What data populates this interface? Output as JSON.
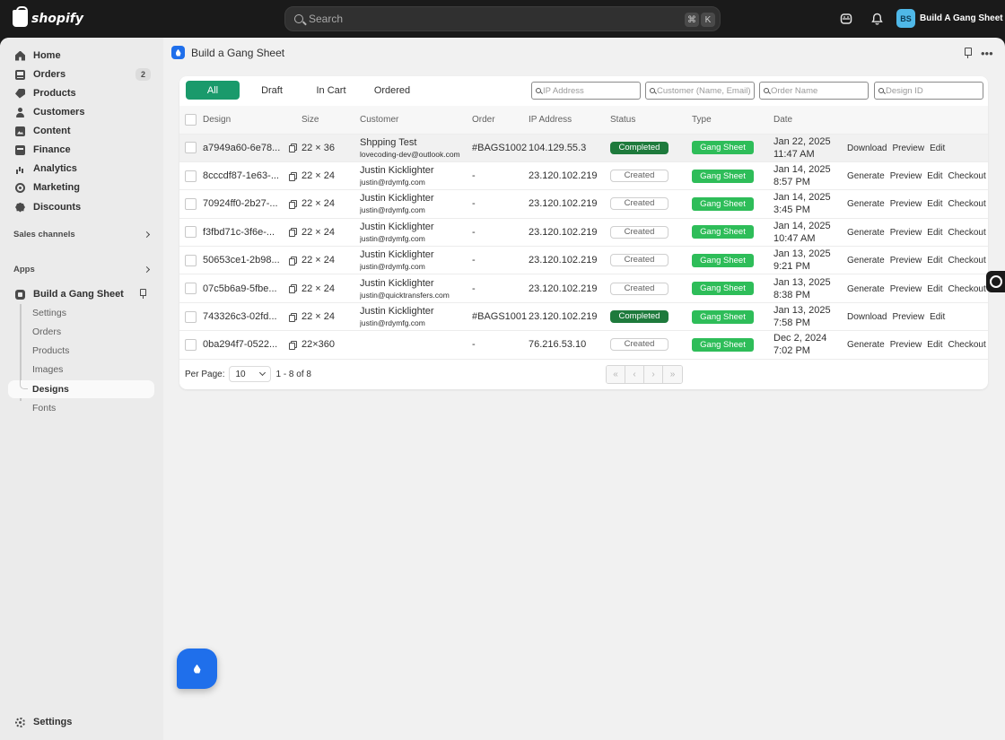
{
  "topbar": {
    "logo_text": "shopify",
    "search_placeholder": "Search",
    "shortcut_cmd": "⌘",
    "shortcut_key": "K",
    "store_initials": "BS",
    "store_name": "Build A Gang Sheet"
  },
  "sidebar": {
    "items": [
      {
        "label": "Home",
        "icon": "home-icon"
      },
      {
        "label": "Orders",
        "icon": "orders-icon",
        "badge": "2"
      },
      {
        "label": "Products",
        "icon": "tag-icon"
      },
      {
        "label": "Customers",
        "icon": "person-icon"
      },
      {
        "label": "Content",
        "icon": "image-icon"
      },
      {
        "label": "Finance",
        "icon": "bank-icon"
      },
      {
        "label": "Analytics",
        "icon": "bar-chart-icon"
      },
      {
        "label": "Marketing",
        "icon": "target-icon"
      },
      {
        "label": "Discounts",
        "icon": "discount-icon"
      }
    ],
    "sales_channels": "Sales channels",
    "apps": "Apps",
    "app_name": "Build a Gang Sheet",
    "sub_items": [
      "Settings",
      "Orders",
      "Products",
      "Images",
      "Designs",
      "Fonts"
    ],
    "active_sub": "Designs",
    "settings": "Settings"
  },
  "header": {
    "app_title": "Build a Gang Sheet"
  },
  "tabs": [
    "All",
    "Draft",
    "In Cart",
    "Ordered"
  ],
  "filters": {
    "ip": "IP Address",
    "customer": "Customer (Name, Email)",
    "order": "Order Name",
    "design": "Design ID"
  },
  "table": {
    "columns": [
      "Design",
      "Size",
      "Customer",
      "Order",
      "IP Address",
      "Status",
      "Type",
      "Date"
    ],
    "rows": [
      {
        "design": "a7949a60-6e78...",
        "size": "22 × 36",
        "name": "Shpping Test",
        "email": "lovecoding-dev@outlook.com",
        "order": "#BAGS1002",
        "ip": "104.129.55.3",
        "status": "Completed",
        "type": "Gang Sheet",
        "date1": "Jan 22, 2025",
        "date2": "11:47 AM",
        "actions": [
          "Download",
          "Preview",
          "Edit"
        ]
      },
      {
        "design": "8cccdf87-1e63-...",
        "size": "22 × 24",
        "name": "Justin Kicklighter",
        "email": "justin@rdymfg.com",
        "order": "-",
        "ip": "23.120.102.219",
        "status": "Created",
        "type": "Gang Sheet",
        "date1": "Jan 14, 2025",
        "date2": "8:57 PM",
        "actions": [
          "Generate",
          "Preview",
          "Edit",
          "Checkout"
        ]
      },
      {
        "design": "70924ff0-2b27-...",
        "size": "22 × 24",
        "name": "Justin Kicklighter",
        "email": "justin@rdymfg.com",
        "order": "-",
        "ip": "23.120.102.219",
        "status": "Created",
        "type": "Gang Sheet",
        "date1": "Jan 14, 2025",
        "date2": "3:45 PM",
        "actions": [
          "Generate",
          "Preview",
          "Edit",
          "Checkout"
        ]
      },
      {
        "design": "f3fbd71c-3f6e-...",
        "size": "22 × 24",
        "name": "Justin Kicklighter",
        "email": "justin@rdymfg.com",
        "order": "-",
        "ip": "23.120.102.219",
        "status": "Created",
        "type": "Gang Sheet",
        "date1": "Jan 14, 2025",
        "date2": "10:47 AM",
        "actions": [
          "Generate",
          "Preview",
          "Edit",
          "Checkout"
        ]
      },
      {
        "design": "50653ce1-2b98...",
        "size": "22 × 24",
        "name": "Justin Kicklighter",
        "email": "justin@rdymfg.com",
        "order": "-",
        "ip": "23.120.102.219",
        "status": "Created",
        "type": "Gang Sheet",
        "date1": "Jan 13, 2025",
        "date2": "9:21 PM",
        "actions": [
          "Generate",
          "Preview",
          "Edit",
          "Checkout"
        ]
      },
      {
        "design": "07c5b6a9-5fbe...",
        "size": "22 × 24",
        "name": "Justin Kicklighter",
        "email": "justin@quicktransfers.com",
        "order": "-",
        "ip": "23.120.102.219",
        "status": "Created",
        "type": "Gang Sheet",
        "date1": "Jan 13, 2025",
        "date2": "8:38 PM",
        "actions": [
          "Generate",
          "Preview",
          "Edit",
          "Checkout"
        ]
      },
      {
        "design": "743326c3-02fd...",
        "size": "22 × 24",
        "name": "Justin Kicklighter",
        "email": "justin@rdymfg.com",
        "order": "#BAGS1001",
        "ip": "23.120.102.219",
        "status": "Completed",
        "type": "Gang Sheet",
        "date1": "Jan 13, 2025",
        "date2": "7:58 PM",
        "actions": [
          "Download",
          "Preview",
          "Edit"
        ]
      },
      {
        "design": "0ba294f7-0522...",
        "size": "22×360",
        "name": "",
        "email": "",
        "order": "-",
        "ip": "76.216.53.10",
        "status": "Created",
        "type": "Gang Sheet",
        "date1": "Dec 2, 2024",
        "date2": "7:02 PM",
        "actions": [
          "Generate",
          "Preview",
          "Edit",
          "Checkout"
        ]
      }
    ]
  },
  "pagination": {
    "per_page_label": "Per Page:",
    "per_page_value": "10",
    "range": "1 - 8 of 8",
    "buttons": [
      "«",
      "‹",
      "›",
      "»"
    ]
  },
  "colors": {
    "active_tab": "#1a9a6b",
    "completed": "#1e7a3c",
    "gang_sheet": "#2ebd59",
    "app_blue": "#1f6feb"
  }
}
